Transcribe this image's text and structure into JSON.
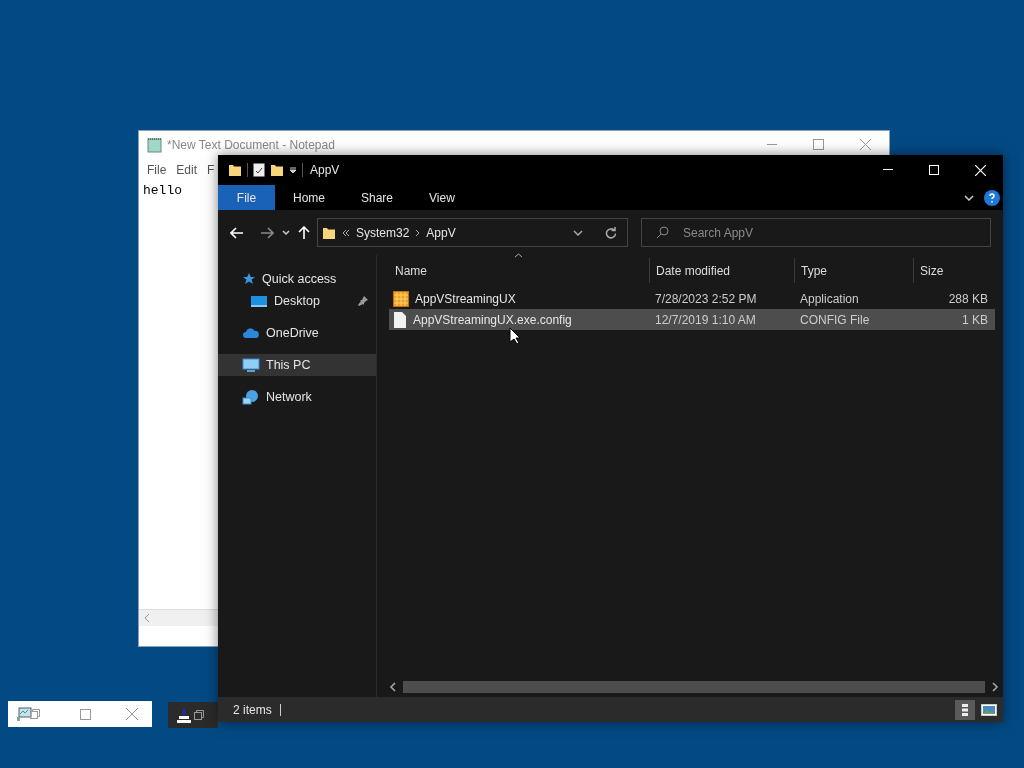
{
  "notepad": {
    "title": "*New Text Document - Notepad",
    "menu": [
      "File",
      "Edit",
      "F"
    ],
    "text": "hello"
  },
  "explorer": {
    "title": "AppV",
    "ribbon_tabs": [
      {
        "label": "File",
        "selected": true
      },
      {
        "label": "Home",
        "selected": false
      },
      {
        "label": "Share",
        "selected": false
      },
      {
        "label": "View",
        "selected": false
      }
    ],
    "breadcrumb": [
      "System32",
      "AppV"
    ],
    "search": {
      "placeholder": "Search AppV"
    },
    "nav": [
      {
        "label": "Quick access",
        "kind": "star",
        "selected": false,
        "children": [
          {
            "label": "Desktop",
            "kind": "desktop",
            "selected": false,
            "pinned": true
          }
        ]
      },
      {
        "label": "OneDrive",
        "kind": "cloud",
        "selected": false
      },
      {
        "label": "This PC",
        "kind": "pc",
        "selected": true
      },
      {
        "label": "Network",
        "kind": "network",
        "selected": false
      }
    ],
    "columns": [
      "Name",
      "Date modified",
      "Type",
      "Size"
    ],
    "rows": [
      {
        "kind": "app",
        "name": "AppVStreamingUX",
        "date": "7/28/2023 2:52 PM",
        "type": "Application",
        "size": "288 KB",
        "selected": false
      },
      {
        "kind": "file",
        "name": "AppVStreamingUX.exe.config",
        "date": "12/7/2019 1:10 AM",
        "type": "CONFIG File",
        "size": "1 KB",
        "selected": true
      }
    ],
    "status": "2 items",
    "views": [
      {
        "kind": "details",
        "selected": true
      },
      {
        "kind": "large-icons",
        "selected": false
      }
    ]
  }
}
